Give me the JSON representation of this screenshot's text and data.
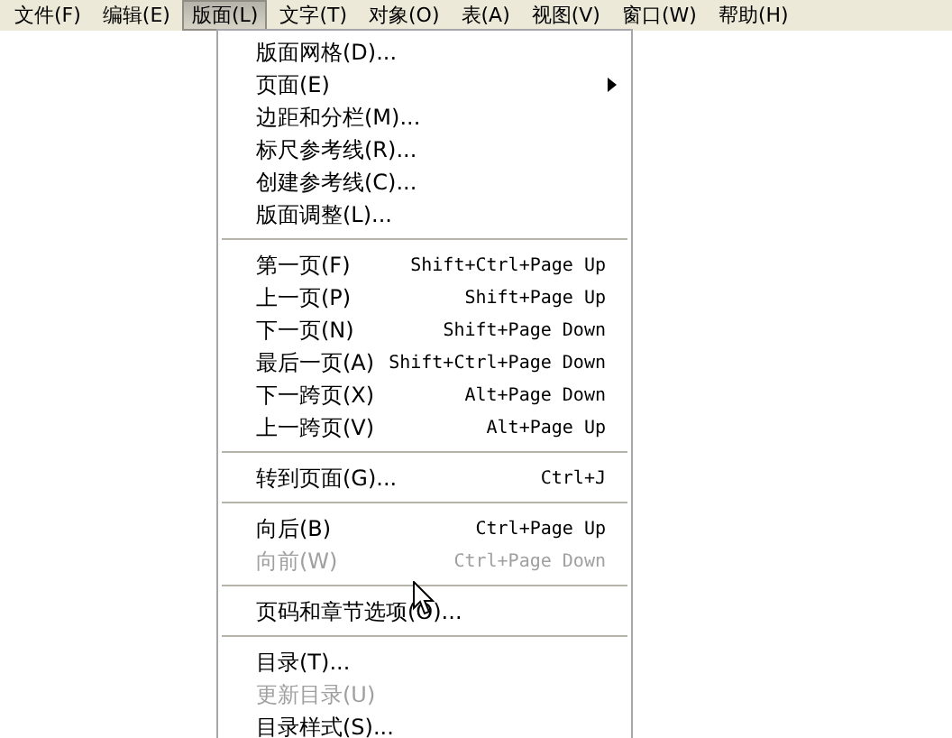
{
  "menubar": [
    {
      "label": "文件(F)",
      "selected": false
    },
    {
      "label": "编辑(E)",
      "selected": false
    },
    {
      "label": "版面(L)",
      "selected": true
    },
    {
      "label": "文字(T)",
      "selected": false
    },
    {
      "label": "对象(O)",
      "selected": false
    },
    {
      "label": "表(A)",
      "selected": false
    },
    {
      "label": "视图(V)",
      "selected": false
    },
    {
      "label": "窗口(W)",
      "selected": false
    },
    {
      "label": "帮助(H)",
      "selected": false
    }
  ],
  "menu": {
    "sections": [
      {
        "items": [
          {
            "kind": "item",
            "label": "版面网格(D)...",
            "disabled": false
          },
          {
            "kind": "submenu",
            "label": "页面(E)",
            "disabled": false
          },
          {
            "kind": "item",
            "label": "边距和分栏(M)...",
            "disabled": false
          },
          {
            "kind": "item",
            "label": "标尺参考线(R)...",
            "disabled": false
          },
          {
            "kind": "item",
            "label": "创建参考线(C)...",
            "disabled": false
          },
          {
            "kind": "item",
            "label": "版面调整(L)...",
            "disabled": false
          }
        ]
      },
      {
        "items": [
          {
            "kind": "item",
            "label": "第一页(F)",
            "shortcut": "Shift+Ctrl+Page Up",
            "disabled": false
          },
          {
            "kind": "item",
            "label": "上一页(P)",
            "shortcut": "Shift+Page Up",
            "disabled": false
          },
          {
            "kind": "item",
            "label": "下一页(N)",
            "shortcut": "Shift+Page Down",
            "disabled": false
          },
          {
            "kind": "item",
            "label": "最后一页(A)",
            "shortcut": "Shift+Ctrl+Page Down",
            "disabled": false
          },
          {
            "kind": "item",
            "label": "下一跨页(X)",
            "shortcut": "Alt+Page Down",
            "disabled": false
          },
          {
            "kind": "item",
            "label": "上一跨页(V)",
            "shortcut": "Alt+Page Up",
            "disabled": false
          }
        ]
      },
      {
        "items": [
          {
            "kind": "item",
            "label": "转到页面(G)...",
            "shortcut": "Ctrl+J",
            "disabled": false
          }
        ]
      },
      {
        "items": [
          {
            "kind": "item",
            "label": "向后(B)",
            "shortcut": "Ctrl+Page Up",
            "disabled": false
          },
          {
            "kind": "item",
            "label": "向前(W)",
            "shortcut": "Ctrl+Page Down",
            "disabled": true
          }
        ]
      },
      {
        "items": [
          {
            "kind": "item",
            "label": "页码和章节选项(O)...",
            "disabled": false
          }
        ]
      },
      {
        "items": [
          {
            "kind": "item",
            "label": "目录(T)...",
            "disabled": false
          },
          {
            "kind": "item",
            "label": "更新目录(U)",
            "disabled": true
          },
          {
            "kind": "item",
            "label": "目录样式(S)...",
            "disabled": false
          }
        ]
      }
    ]
  }
}
